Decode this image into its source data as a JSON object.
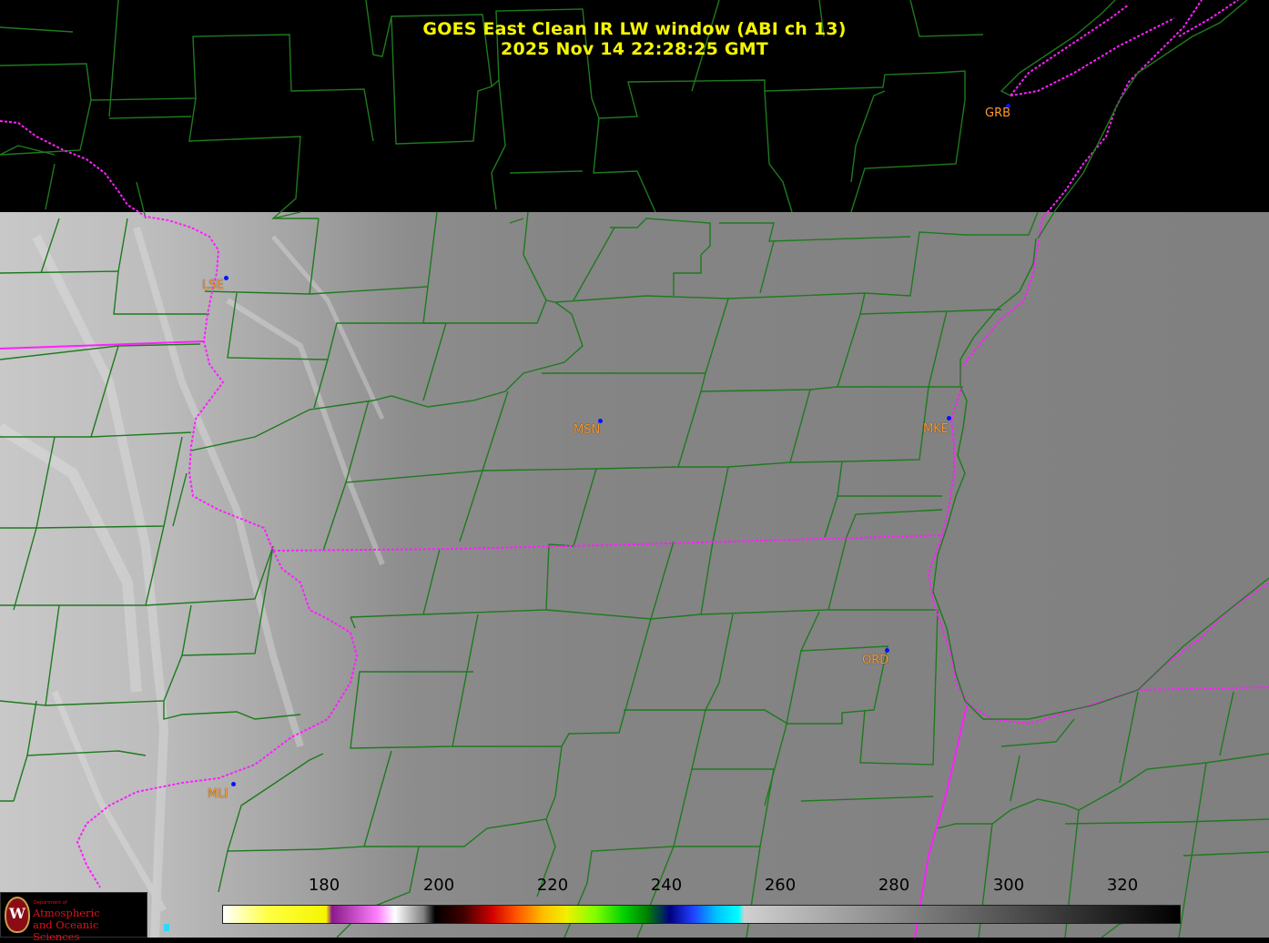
{
  "title": {
    "line1": "GOES East Clean IR LW window (ABI ch 13)",
    "line2": "2025 Nov 14  22:28:25 GMT"
  },
  "stations": [
    {
      "id": "GRB"
    },
    {
      "id": "LSE"
    },
    {
      "id": "MSN"
    },
    {
      "id": "MKE"
    },
    {
      "id": "ORD"
    },
    {
      "id": "MLI"
    }
  ],
  "colorbar": {
    "ticks": [
      "180",
      "200",
      "220",
      "240",
      "260",
      "280",
      "300",
      "320"
    ],
    "min": 163,
    "max": 330,
    "stops": [
      {
        "t": 163,
        "color": "#ffffff"
      },
      {
        "t": 171,
        "color": "#ffff40"
      },
      {
        "t": 181,
        "color": "#f5f500"
      },
      {
        "t": 182,
        "color": "#8a1a8a"
      },
      {
        "t": 190,
        "color": "#ff80ff"
      },
      {
        "t": 193,
        "color": "#ffffff"
      },
      {
        "t": 198,
        "color": "#808080"
      },
      {
        "t": 200,
        "color": "#000000"
      },
      {
        "t": 205,
        "color": "#400000"
      },
      {
        "t": 210,
        "color": "#d00000"
      },
      {
        "t": 214,
        "color": "#ff5000"
      },
      {
        "t": 219,
        "color": "#ffc000"
      },
      {
        "t": 223,
        "color": "#f0f000"
      },
      {
        "t": 228,
        "color": "#80ff00"
      },
      {
        "t": 233,
        "color": "#00d000"
      },
      {
        "t": 237,
        "color": "#008000"
      },
      {
        "t": 241,
        "color": "#000080"
      },
      {
        "t": 245,
        "color": "#2040ff"
      },
      {
        "t": 249,
        "color": "#00c0ff"
      },
      {
        "t": 253,
        "color": "#00ffff"
      },
      {
        "t": 254,
        "color": "#d0d0d0"
      },
      {
        "t": 330,
        "color": "#000000"
      }
    ]
  },
  "logo": {
    "small": "Department of",
    "line1": "Atmospheric",
    "line2": "and Oceanic Sciences",
    "seal": "W"
  },
  "colors": {
    "county_lines": "#1e7a1e",
    "state_lines": "#ff1fff",
    "title": "#f5f500",
    "station_label": "#ff9a2e",
    "station_dot": "#0014ff"
  }
}
